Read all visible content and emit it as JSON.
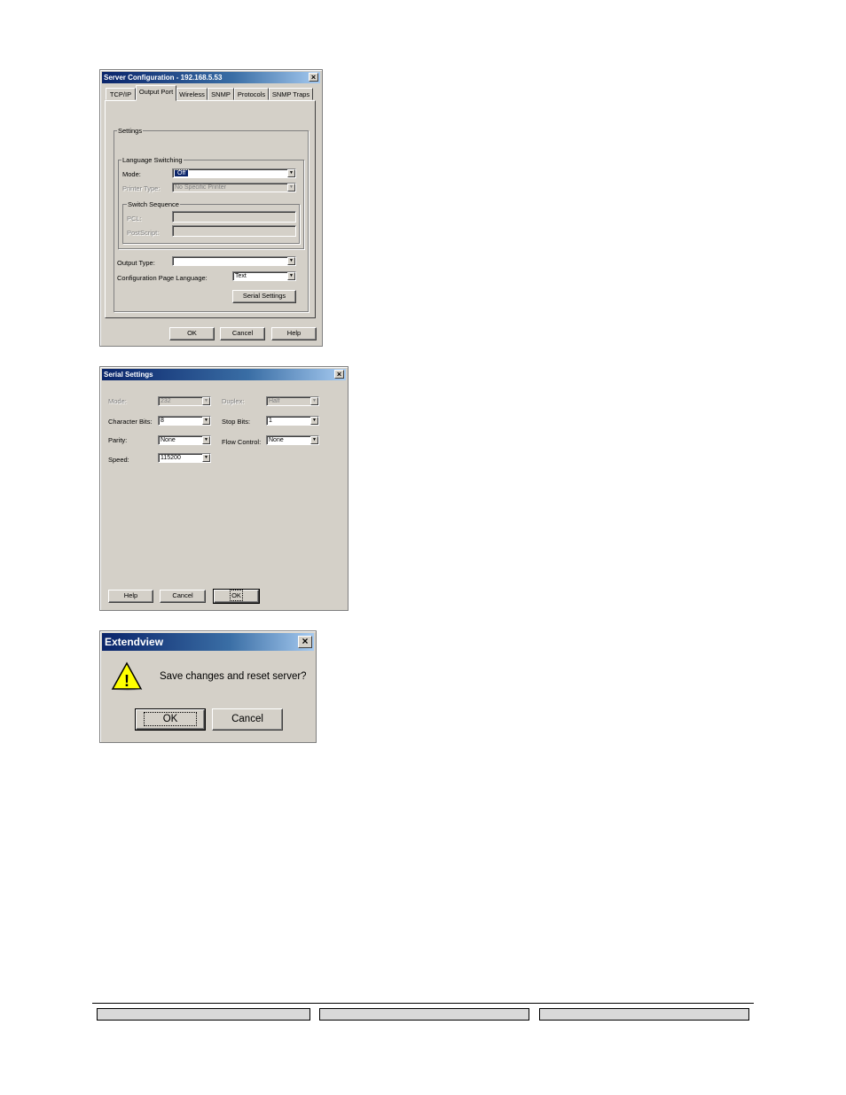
{
  "server_config": {
    "title": "Server Configuration - 192.168.5.53",
    "close": "×",
    "tabs": [
      {
        "label": "TCP/IP"
      },
      {
        "label": "Output Port"
      },
      {
        "label": "Wireless"
      },
      {
        "label": "SNMP"
      },
      {
        "label": "Protocols"
      },
      {
        "label": "SNMP Traps"
      }
    ],
    "active_tab": "Output Port",
    "settings_group": "Settings",
    "language_group": "Language Switching",
    "mode_label": "Mode:",
    "mode_value": "Off",
    "printer_type_label": "Printer Type:",
    "printer_type_value": "No Specific Printer",
    "switch_group": "Switch Sequence",
    "pcl_label": "PCL:",
    "pcl_value": "",
    "postscript_label": "PostScript:",
    "postscript_value": "",
    "output_type_label": "Output Type:",
    "output_type_value": "",
    "config_page_lang_label": "Configuration Page Language:",
    "config_page_lang_value": "Text",
    "serial_settings_button": "Serial Settings",
    "ok": "OK",
    "cancel": "Cancel",
    "help": "Help"
  },
  "serial_settings": {
    "title": "Serial Settings",
    "close": "×",
    "mode_label": "Mode:",
    "mode_value": "232",
    "duplex_label": "Duplex:",
    "duplex_value": "Half",
    "char_bits_label": "Character Bits:",
    "char_bits_value": "8",
    "stop_bits_label": "Stop Bits:",
    "stop_bits_value": "1",
    "parity_label": "Parity:",
    "parity_value": "None",
    "flow_control_label": "Flow Control:",
    "flow_control_value": "None",
    "speed_label": "Speed:",
    "speed_value": "115200",
    "help": "Help",
    "cancel": "Cancel",
    "ok": "OK"
  },
  "extendview": {
    "title": "Extendview",
    "close": "×",
    "message": "Save changes and reset server?",
    "warning_glyph": "!",
    "ok": "OK",
    "cancel": "Cancel"
  },
  "dropdown_glyph": "▼"
}
